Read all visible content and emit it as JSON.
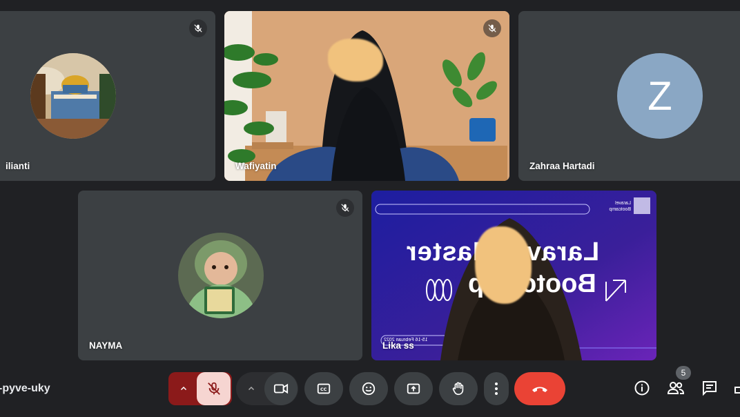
{
  "meeting": {
    "code": "-pyve-uky"
  },
  "participants": [
    {
      "name": "ilianti",
      "muted": true,
      "avatar": "dome-photo"
    },
    {
      "name": "Wafiyatin",
      "muted": true,
      "avatar": "video"
    },
    {
      "name": "Zahraa Hartadi",
      "muted": false,
      "avatar_letter": "Z",
      "avatar_color": "#8aa7c4"
    },
    {
      "name": "NAYMA",
      "muted": true,
      "avatar": "child-photo"
    },
    {
      "name": "Lika ss",
      "muted": false,
      "avatar": "video"
    }
  ],
  "slide": {
    "line1": "Laravel Master",
    "line2": "Bootcamp",
    "logo_text": "Laravel Bootcamp",
    "date_text": "15-16 Februari 2022"
  },
  "controls": {
    "mic_state": "muted",
    "mic_color": "#8b1a1a",
    "end_call_color": "#ea4335",
    "items": [
      "mic-options",
      "microphone",
      "camera-options",
      "camera",
      "captions",
      "reactions",
      "present",
      "raise-hand",
      "more-options",
      "leave-call"
    ]
  },
  "right_panel": {
    "people_count": "5",
    "items": [
      "meeting-details",
      "people",
      "chat",
      "activities"
    ]
  }
}
